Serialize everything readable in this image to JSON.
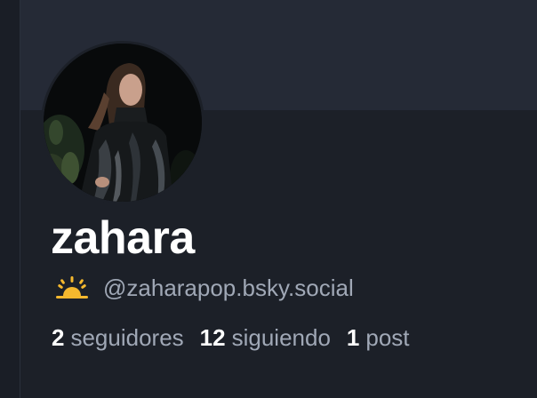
{
  "profile": {
    "display_name": "zahara",
    "handle": "@zaharapop.bsky.social",
    "handle_icon": "sunrise-icon",
    "stats": {
      "followers_count": "2",
      "followers_label": "seguidores",
      "following_count": "12",
      "following_label": "siguiendo",
      "posts_count": "1",
      "posts_label": "post"
    }
  },
  "colors": {
    "background": "#1c2028",
    "banner": "#252a36",
    "text_primary": "#ffffff",
    "text_secondary": "#a0a8b6",
    "icon_accent": "#f5b82e"
  }
}
